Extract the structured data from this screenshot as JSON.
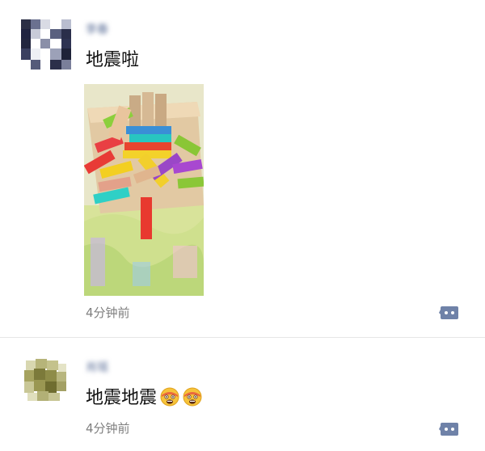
{
  "posts": [
    {
      "username": "李春",
      "content": "地震啦",
      "timestamp": "4分钟前",
      "avatar": "pixelated-avatar",
      "image": "toy-blocks-photo",
      "action_icon": "comment-icon"
    },
    {
      "username": "肖瑶",
      "content": "地震地震",
      "emojis": [
        "scared-face-emoji",
        "scared-face-emoji"
      ],
      "timestamp": "4分钟前",
      "avatar": "pixelated-avatar",
      "action_icon": "comment-icon"
    }
  ],
  "colors": {
    "username": "#576b95",
    "timestamp": "#7f7f7f",
    "icon": "#6f82a8",
    "divider": "#e6e6e6"
  }
}
